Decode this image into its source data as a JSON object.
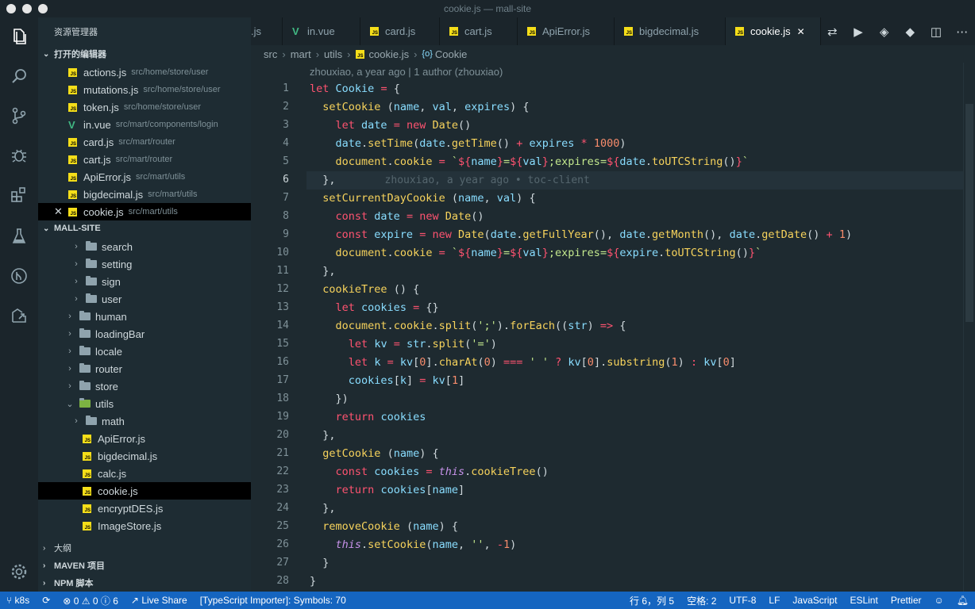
{
  "window": {
    "title": "cookie.js — mall-site"
  },
  "activity_bar": {
    "icons": [
      "files-icon",
      "search-icon",
      "source-control-icon",
      "debug-icon",
      "extensions-icon",
      "flask-icon",
      "git-icon",
      "remote-icon",
      "settings-gear-icon"
    ]
  },
  "sidebar": {
    "title": "资源管理器",
    "open_editors_label": "打开的编辑器",
    "open_editors": [
      {
        "name": "actions.js",
        "path": "src/home/store/user",
        "type": "js"
      },
      {
        "name": "mutations.js",
        "path": "src/home/store/user",
        "type": "js"
      },
      {
        "name": "token.js",
        "path": "src/home/store/user",
        "type": "js"
      },
      {
        "name": "in.vue",
        "path": "src/mart/components/login",
        "type": "vue"
      },
      {
        "name": "card.js",
        "path": "src/mart/router",
        "type": "js"
      },
      {
        "name": "cart.js",
        "path": "src/mart/router",
        "type": "js"
      },
      {
        "name": "ApiError.js",
        "path": "src/mart/utils",
        "type": "js"
      },
      {
        "name": "bigdecimal.js",
        "path": "src/mart/utils",
        "type": "js"
      },
      {
        "name": "cookie.js",
        "path": "src/mart/utils",
        "type": "js",
        "selected": true
      }
    ],
    "project_label": "MALL-SITE",
    "tree": [
      {
        "name": "search",
        "kind": "folder",
        "depth": 2
      },
      {
        "name": "setting",
        "kind": "folder",
        "depth": 2
      },
      {
        "name": "sign",
        "kind": "folder",
        "depth": 2
      },
      {
        "name": "user",
        "kind": "folder",
        "depth": 2
      },
      {
        "name": "human",
        "kind": "folder",
        "depth": 1
      },
      {
        "name": "loadingBar",
        "kind": "folder",
        "depth": 1
      },
      {
        "name": "locale",
        "kind": "folder",
        "depth": 1
      },
      {
        "name": "router",
        "kind": "folder",
        "depth": 1
      },
      {
        "name": "store",
        "kind": "folder",
        "depth": 1
      },
      {
        "name": "utils",
        "kind": "folder-open",
        "depth": 1
      },
      {
        "name": "math",
        "kind": "folder",
        "depth": 2
      },
      {
        "name": "ApiError.js",
        "kind": "js",
        "depth": 2
      },
      {
        "name": "bigdecimal.js",
        "kind": "js",
        "depth": 2
      },
      {
        "name": "calc.js",
        "kind": "js",
        "depth": 2
      },
      {
        "name": "cookie.js",
        "kind": "js",
        "depth": 2,
        "selected": true
      },
      {
        "name": "encryptDES.js",
        "kind": "js",
        "depth": 2
      },
      {
        "name": "ImageStore.js",
        "kind": "js",
        "depth": 2
      }
    ],
    "outline_label": "大纲",
    "maven_label": "MAVEN 项目",
    "npm_label": "NPM 脚本"
  },
  "tabs": [
    {
      "label": ".js",
      "type": "none"
    },
    {
      "label": "in.vue",
      "type": "vue"
    },
    {
      "label": "card.js",
      "type": "js"
    },
    {
      "label": "cart.js",
      "type": "js"
    },
    {
      "label": "ApiError.js",
      "type": "js"
    },
    {
      "label": "bigdecimal.js",
      "type": "js"
    },
    {
      "label": "cookie.js",
      "type": "js",
      "active": true
    }
  ],
  "breadcrumb": [
    "src",
    "mart",
    "utils",
    "cookie.js",
    "Cookie"
  ],
  "blame_header": "zhouxiao, a year ago | 1 author (zhouxiao)",
  "inline_blame": "zhouxiao, a year ago • toc-client",
  "current_line": 6,
  "code_lines": [
    "let Cookie = {",
    "  setCookie (name, val, expires) {",
    "    let date = new Date()",
    "    date.setTime(date.getTime() + expires * 1000)",
    "    document.cookie = `${name}=${val};expires=${date.toUTCString()}`",
    "  },",
    "  setCurrentDayCookie (name, val) {",
    "    const date = new Date()",
    "    const expire = new Date(date.getFullYear(), date.getMonth(), date.getDate() + 1)",
    "    document.cookie = `${name}=${val};expires=${expire.toUTCString()}`",
    "  },",
    "  cookieTree () {",
    "    let cookies = {}",
    "    document.cookie.split(';').forEach((str) => {",
    "      let kv = str.split('=')",
    "      let k = kv[0].charAt(0) === ' ' ? kv[0].substring(1) : kv[0]",
    "      cookies[k] = kv[1]",
    "    })",
    "    return cookies",
    "  },",
    "  getCookie (name) {",
    "    const cookies = this.cookieTree()",
    "    return cookies[name]",
    "  },",
    "  removeCookie (name) {",
    "    this.setCookie(name, '', -1)",
    "  }",
    "}"
  ],
  "status": {
    "branch": "k8s",
    "errors": "0",
    "warnings": "0",
    "infos": "6",
    "live_share": "Live Share",
    "ts_importer": "[TypeScript Importer]: Symbols: 70",
    "position": "行 6，列 5",
    "spaces": "空格: 2",
    "encoding": "UTF-8",
    "eol": "LF",
    "language": "JavaScript",
    "eslint": "ESLint",
    "prettier": "Prettier"
  }
}
